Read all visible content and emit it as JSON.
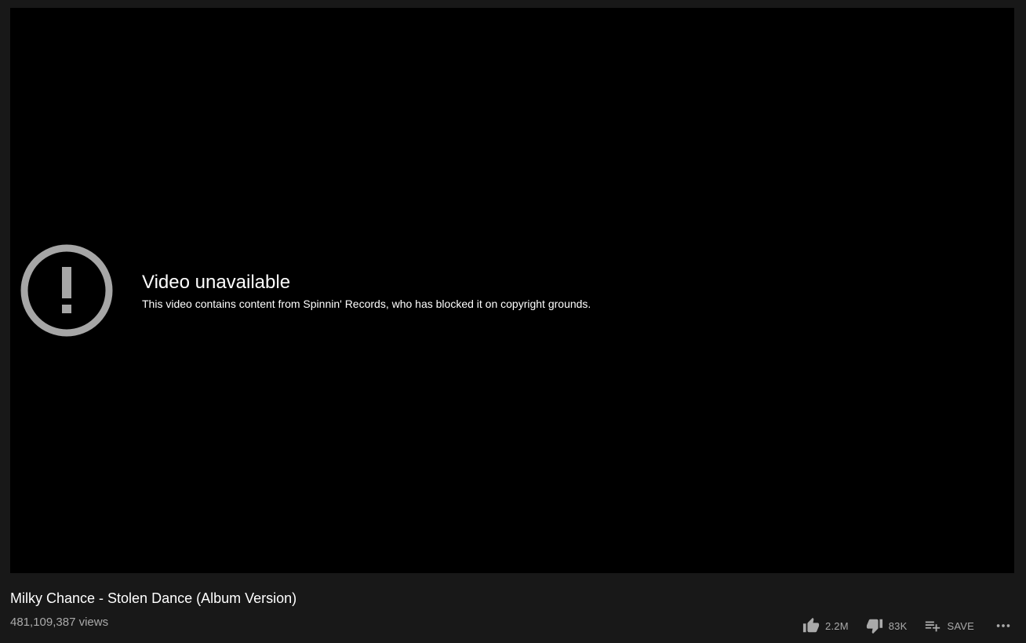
{
  "player": {
    "error_title": "Video unavailable",
    "error_message": "This video contains content from Spinnin' Records, who has blocked it on copyright grounds.",
    "error_icon": "alert-circle-icon"
  },
  "video": {
    "title": "Milky Chance - Stolen Dance (Album Version)",
    "views": "481,109,387 views"
  },
  "actions": {
    "like_count": "2.2M",
    "dislike_count": "83K",
    "save_label": "SAVE",
    "like_icon": "thumbs-up-icon",
    "dislike_icon": "thumbs-down-icon",
    "save_icon": "playlist-add-icon",
    "more_icon": "more-horizontal-icon"
  },
  "colors": {
    "page_background": "#181818",
    "player_background": "#000000",
    "icon_gray": "#aaaaaa",
    "text_primary": "#ffffff",
    "text_secondary": "#aaaaaa"
  }
}
